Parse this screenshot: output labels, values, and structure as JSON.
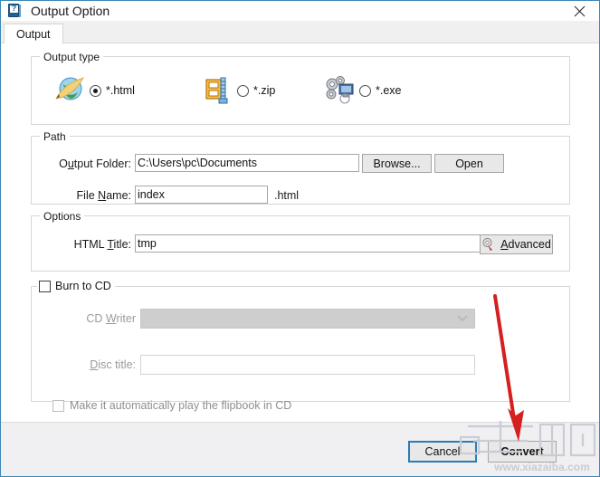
{
  "window": {
    "title": "Output Option",
    "icon": "help-book-icon",
    "close_icon": "close-icon"
  },
  "tabs": [
    {
      "label": "Output",
      "active": true
    }
  ],
  "output_type": {
    "group_title": "Output type",
    "options": [
      {
        "label": "*.html",
        "icon": "globe-html-icon",
        "selected": true
      },
      {
        "label": "*.zip",
        "icon": "zip-archive-icon",
        "selected": false
      },
      {
        "label": "*.exe",
        "icon": "gears-exe-icon",
        "selected": false
      }
    ]
  },
  "path": {
    "group_title": "Path",
    "output_folder_label": "Output Folder:",
    "output_folder_accel": "u",
    "output_folder_value": "C:\\Users\\pc\\Documents",
    "browse_button": "Browse...",
    "open_button": "Open",
    "file_name_label": "File Name:",
    "file_name_accel": "N",
    "file_name_value": "index",
    "file_extension": ".html"
  },
  "options": {
    "group_title": "Options",
    "html_title_label": "HTML Title:",
    "html_title_accel": "T",
    "html_title_value": "tmp",
    "advanced_button": "Advanced",
    "advanced_accel": "A",
    "advanced_icon": "gear-icon"
  },
  "burn": {
    "checkbox_label": "Burn to CD",
    "checked": false,
    "cd_writer_label": "CD Writer",
    "cd_writer_accel": "W",
    "cd_writer_value": "",
    "cd_writer_enabled": false,
    "disc_title_label": "Disc title:",
    "disc_title_accel": "D",
    "disc_title_value": "",
    "autoplay_label": "Make it automatically play the flipbook in CD",
    "autoplay_checked": false,
    "chevron_icon": "chevron-down-icon"
  },
  "footer": {
    "cancel_button": "Cancel",
    "convert_button": "Convert"
  },
  "annotation": {
    "arrow": "red-arrow-pointing-to-convert",
    "arrow_color": "#d61f1f"
  },
  "watermark": {
    "text": "www.xiazaiba.com",
    "logo_text": "下载吧",
    "color": "#c9ccd4"
  }
}
